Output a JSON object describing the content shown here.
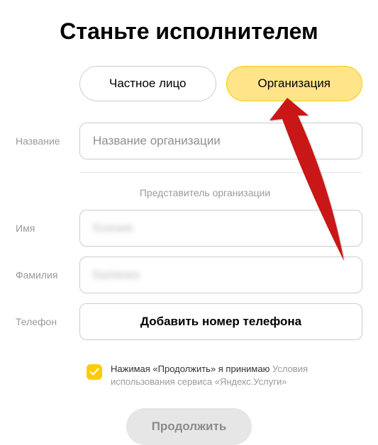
{
  "title": "Станьте исполнителем",
  "tabs": {
    "private": "Частное лицо",
    "org": "Организация"
  },
  "labels": {
    "name": "Название",
    "firstname": "Имя",
    "lastname": "Фамилия",
    "phone": "Телефон"
  },
  "section_label": "Представитель организации",
  "placeholders": {
    "org_name": "Название организации"
  },
  "prefilled": {
    "firstname": "Ксения",
    "lastname": "Калинка"
  },
  "phone_button": "Добавить номер телефона",
  "terms": {
    "prefix": "Нажимая «Продолжить» я принимаю ",
    "link": "Условия использования сервиса «Яндекс.Услуги»"
  },
  "continue": "Продолжить",
  "colors": {
    "accent": "#ffcc00",
    "tab_active_bg": "#ffe48a",
    "muted": "#9a9a9a"
  }
}
